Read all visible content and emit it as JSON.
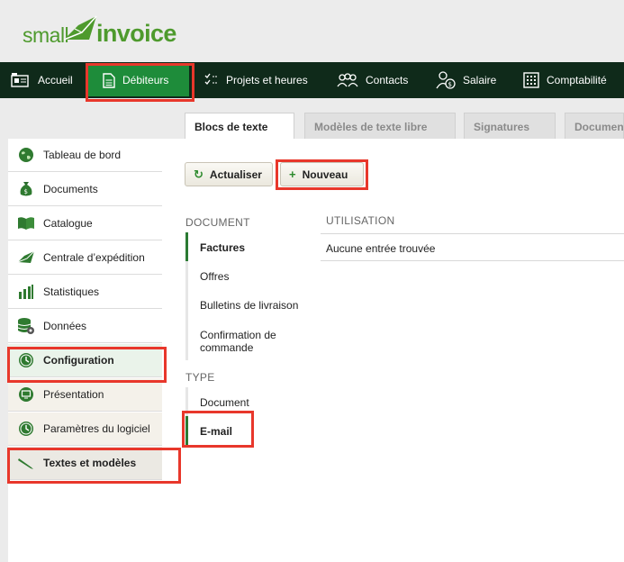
{
  "logo": {
    "part1": "small",
    "part2": "invoice"
  },
  "nav": [
    {
      "label": "Accueil",
      "icon": "home-icon"
    },
    {
      "label": "Débiteurs",
      "icon": "document-icon"
    },
    {
      "label": "Projets et heures",
      "icon": "checklist-icon"
    },
    {
      "label": "Contacts",
      "icon": "people-icon"
    },
    {
      "label": "Salaire",
      "icon": "salary-icon"
    },
    {
      "label": "Comptabilité",
      "icon": "calculator-icon"
    }
  ],
  "tabs": [
    "Blocs de texte",
    "Modèles de texte libre",
    "Signatures",
    "Documents"
  ],
  "sidebar": [
    {
      "label": "Tableau de bord",
      "icon": "globe-icon"
    },
    {
      "label": "Documents",
      "icon": "money-bag-icon"
    },
    {
      "label": "Catalogue",
      "icon": "book-icon"
    },
    {
      "label": "Centrale d’expédition",
      "icon": "envelope-icon"
    },
    {
      "label": "Statistiques",
      "icon": "bar-chart-icon"
    },
    {
      "label": "Données",
      "icon": "database-icon"
    },
    {
      "label": "Configuration",
      "icon": "clock-icon"
    },
    {
      "label": "Présentation",
      "icon": "monitor-icon"
    },
    {
      "label": "Paramètres du logiciel",
      "icon": "clock-icon"
    },
    {
      "label": "Textes et modèles",
      "icon": "pen-icon"
    }
  ],
  "toolbar": {
    "refresh_label": "Actualiser",
    "new_label": "Nouveau"
  },
  "document_section": {
    "title": "DOCUMENT",
    "items": [
      "Factures",
      "Offres",
      "Bulletins de livraison",
      "Confirmation de commande"
    ]
  },
  "type_section": {
    "title": "TYPE",
    "items": [
      "Document",
      "E-mail"
    ]
  },
  "usage": {
    "header": "UTILISATION",
    "empty": "Aucune entrée trouvée"
  },
  "colors": {
    "nav_bg": "#0f2a1a",
    "nav_active": "#1e8c3a",
    "accent_green": "#2b7a33",
    "highlight_red": "#e8372b"
  }
}
